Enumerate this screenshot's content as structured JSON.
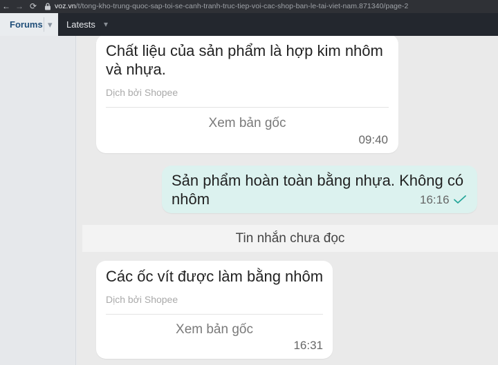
{
  "browser": {
    "url_host": "voz.vn",
    "url_path": "/t/tong-kho-trung-quoc-sap-toi-se-canh-tranh-truc-tiep-voi-cac-shop-ban-le-tai-viet-nam.871340/page-2"
  },
  "nav": {
    "forums_label": "Forums",
    "latest_label": "Latests"
  },
  "messages": [
    {
      "direction": "incoming",
      "text": "Chất liệu của sản phẩm là hợp kim nhôm và nhựa.",
      "translated_by": "Dịch bởi Shopee",
      "view_original": "Xem bản gốc",
      "time": "09:40"
    },
    {
      "direction": "outgoing",
      "text": "Sản phẩm hoàn toàn bằng nhựa. Không có nhôm",
      "time": "16:16",
      "status_icon": "double-check-icon"
    },
    {
      "direction": "incoming",
      "text": "Các ốc vít được làm bằng nhôm",
      "translated_by": "Dịch bởi Shopee",
      "view_original": "Xem bản gốc",
      "time": "16:31"
    }
  ],
  "unread_divider": "Tin nhắn chưa đọc",
  "colors": {
    "incoming_bubble": "#ffffff",
    "outgoing_bubble": "#dcf2ef",
    "check_color": "#26a69a",
    "nav_bg": "#23272e"
  }
}
